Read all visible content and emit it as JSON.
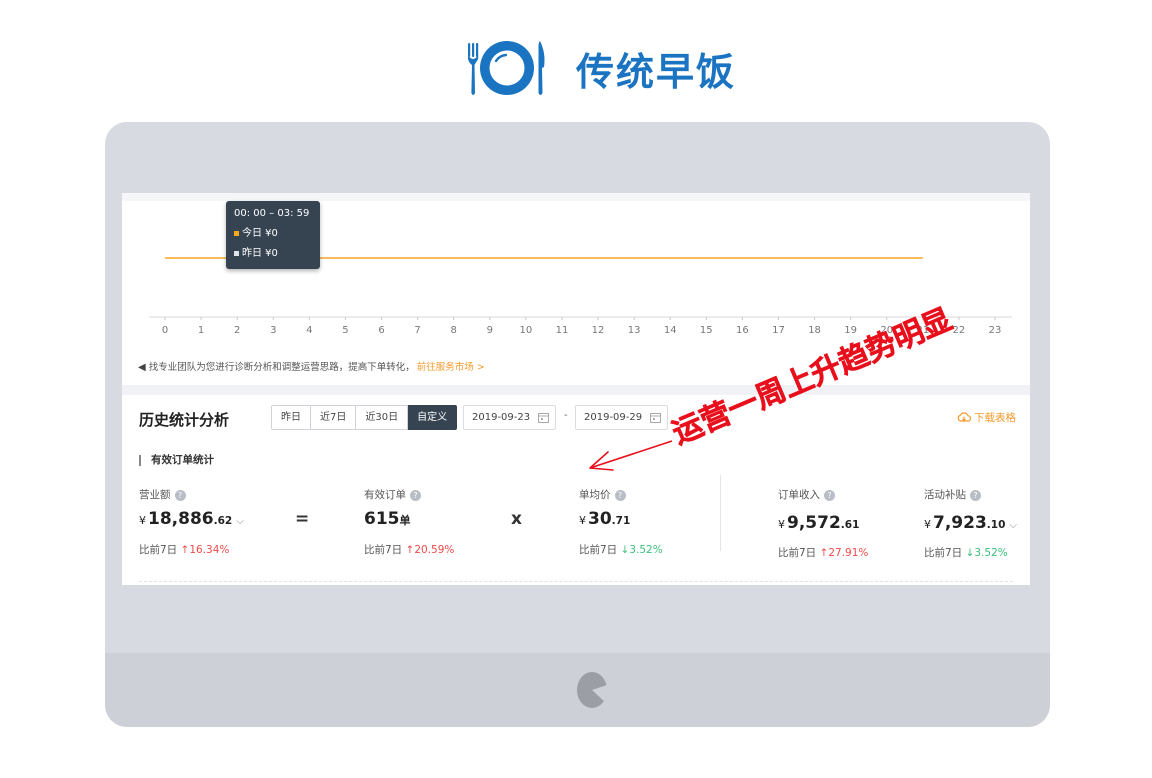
{
  "brand": {
    "title": "传统早饭",
    "logo": "plate-fork-knife-icon",
    "color": "#1b74c2"
  },
  "chart": {
    "x_ticks": [
      "0",
      "1",
      "2",
      "3",
      "4",
      "5",
      "6",
      "7",
      "8",
      "9",
      "10",
      "11",
      "12",
      "13",
      "14",
      "15",
      "16",
      "17",
      "18",
      "19",
      "20",
      "21",
      "22",
      "23"
    ],
    "tooltip": {
      "time": "00: 00 – 03: 59",
      "today": "今日 ¥0",
      "yesterday": "昨日 ¥0"
    }
  },
  "chart_data": {
    "type": "line",
    "x": [
      0,
      1,
      2,
      3,
      4,
      5,
      6,
      7,
      8,
      9,
      10,
      11,
      12,
      13,
      14,
      15,
      16,
      17,
      18,
      19,
      20,
      21,
      22,
      23
    ],
    "series": [
      {
        "name": "今日",
        "values": [
          0,
          0,
          0,
          0,
          0,
          0,
          0,
          0,
          0,
          0,
          0,
          0,
          0,
          0,
          0,
          0,
          0,
          0,
          0,
          0,
          0,
          0
        ],
        "color": "#f5a623"
      }
    ],
    "xlim": [
      0,
      23
    ],
    "grid": false
  },
  "notice": {
    "text": "找专业团队为您进行诊断分析和调整运营思路，提高下单转化，",
    "link": "前往服务市场 >"
  },
  "history": {
    "title": "历史统计分析",
    "ranges": [
      "昨日",
      "近7日",
      "近30日",
      "自定义"
    ],
    "active_range": "自定义",
    "date_start": "2019-09-23",
    "date_sep": "-",
    "date_end": "2019-09-29",
    "download": "下载表格",
    "subtitle": "有效订单统计"
  },
  "metrics": {
    "revenue": {
      "label": "营业额",
      "yen": "¥",
      "int": "18,886",
      "dec": ".62",
      "compare_prefix": "比前7日",
      "arrow": "↑",
      "change": "16.34%"
    },
    "orders": {
      "label": "有效订单",
      "int": "615",
      "unit": "单",
      "compare_prefix": "比前7日",
      "arrow": "↑",
      "change": "20.59%"
    },
    "avg_price": {
      "label": "单均价",
      "yen": "¥",
      "int": "30",
      "dec": ".71",
      "compare_prefix": "比前7日",
      "arrow": "↓",
      "change": "3.52%"
    },
    "order_income": {
      "label": "订单收入",
      "yen": "¥",
      "int": "9,572",
      "dec": ".61",
      "compare_prefix": "比前7日",
      "arrow": "↑",
      "change": "27.91%"
    },
    "subsidy": {
      "label": "活动补贴",
      "yen": "¥",
      "int": "7,923",
      "dec": ".10",
      "compare_prefix": "比前7日",
      "arrow": "↓",
      "change": "3.52%"
    },
    "eq": "=",
    "times": "x"
  },
  "annotation": {
    "text": "运营一周上升趋势明显",
    "color": "#e8101c"
  }
}
